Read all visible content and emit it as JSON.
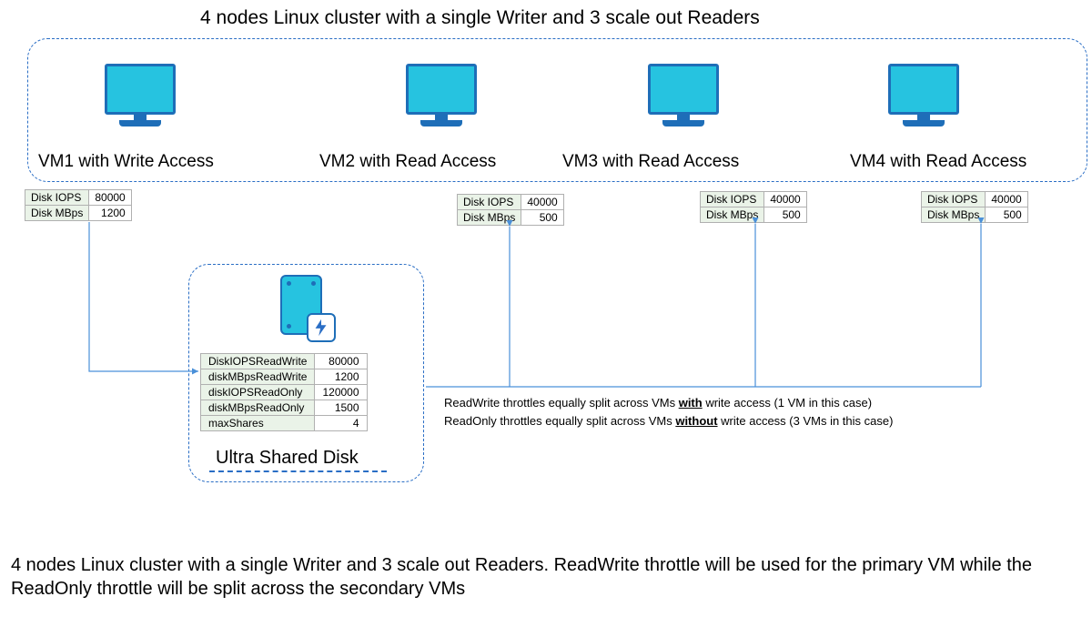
{
  "title": "4 nodes Linux cluster with a single Writer and 3 scale out Readers",
  "vms": [
    {
      "label": "VM1 with Write Access",
      "stats": {
        "iops_label": "Disk IOPS",
        "iops": 80000,
        "mbps_label": "Disk MBps",
        "mbps": 1200
      }
    },
    {
      "label": "VM2 with Read Access",
      "stats": {
        "iops_label": "Disk IOPS",
        "iops": 40000,
        "mbps_label": "Disk MBps",
        "mbps": 500
      }
    },
    {
      "label": "VM3 with Read Access",
      "stats": {
        "iops_label": "Disk IOPS",
        "iops": 40000,
        "mbps_label": "Disk MBps",
        "mbps": 500
      }
    },
    {
      "label": "VM4 with Read Access",
      "stats": {
        "iops_label": "Disk IOPS",
        "iops": 40000,
        "mbps_label": "Disk MBps",
        "mbps": 500
      }
    }
  ],
  "disk": {
    "title": "Ultra Shared Disk",
    "props": [
      {
        "label": "DiskIOPSReadWrite",
        "value": 80000
      },
      {
        "label": "diskMBpsReadWrite",
        "value": 1200
      },
      {
        "label": "diskIOPSReadOnly",
        "value": 120000
      },
      {
        "label": "diskMBpsReadOnly",
        "value": 1500
      },
      {
        "label": "maxShares",
        "value": 4
      }
    ]
  },
  "explain": {
    "line1_a": "ReadWrite throttles equally split across VMs ",
    "line1_b": "with",
    "line1_c": " write access (1 VM in this case)",
    "line2_a": "ReadOnly throttles equally split across VMs ",
    "line2_b": "without",
    "line2_c": " write access (3 VMs in this case)"
  },
  "caption": "4 nodes Linux cluster with a single Writer and 3 scale out Readers. ReadWrite throttle will be used for the primary VM while the ReadOnly throttle will be split across the secondary VMs"
}
